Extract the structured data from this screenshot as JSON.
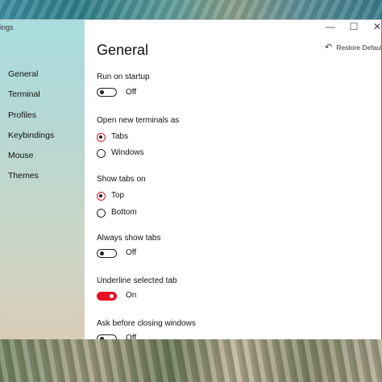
{
  "window": {
    "title": "ings"
  },
  "sidebar": {
    "items": [
      {
        "label": "General"
      },
      {
        "label": "Terminal"
      },
      {
        "label": "Profiles"
      },
      {
        "label": "Keybindings"
      },
      {
        "label": "Mouse"
      },
      {
        "label": "Themes"
      }
    ]
  },
  "header": {
    "title": "General",
    "restore_label": "Restore Defaults",
    "restore_icon": "↶"
  },
  "controls": {
    "minimize": "—",
    "maximize": "☐",
    "close": "✕"
  },
  "settings": {
    "run_on_startup": {
      "label": "Run on startup",
      "state": "Off"
    },
    "open_new_terminals_as": {
      "label": "Open new terminals as",
      "options": [
        "Tabs",
        "Windows"
      ],
      "selected": "Tabs"
    },
    "show_tabs_on": {
      "label": "Show tabs on",
      "options": [
        "Top",
        "Bottom"
      ],
      "selected": "Top"
    },
    "always_show_tabs": {
      "label": "Always show tabs",
      "state": "Off"
    },
    "underline_selected_tab": {
      "label": "Underline selected tab",
      "state": "On"
    },
    "ask_before_closing": {
      "label": "Ask before closing windows",
      "state": "Off"
    }
  },
  "colors": {
    "accent": "#e81123"
  }
}
